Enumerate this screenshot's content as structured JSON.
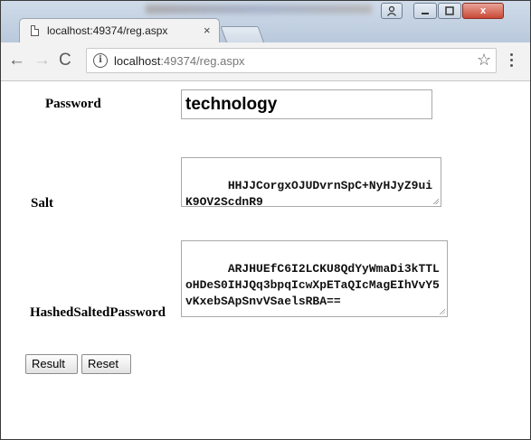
{
  "browser": {
    "tab_title": "localhost:49374/reg.aspx",
    "tab_close": "×",
    "url_host": "localhost",
    "url_path": ":49374/reg.aspx",
    "back": "←",
    "forward": "→",
    "reload": "C",
    "bookmark": "☆",
    "info": "i",
    "window_close": "x"
  },
  "form": {
    "password_label": "Password",
    "password_value": "technology",
    "salt_label": "Salt",
    "salt_value": "HHJJCorgxOJUDvrnSpC+NyHJyZ9uiK9OV2ScdnR9",
    "hash_label": "HashedSaltedPassword",
    "hash_value": "ARJHUEfC6I2LCKU8QdYyWmaDi3kTTLoHDeS0IHJQq3bpqIcwXpETaQIcMagEIhVvY5vKxebSApSnvVSaelsRBA==",
    "result_button": "Result",
    "reset_button": "Reset"
  }
}
